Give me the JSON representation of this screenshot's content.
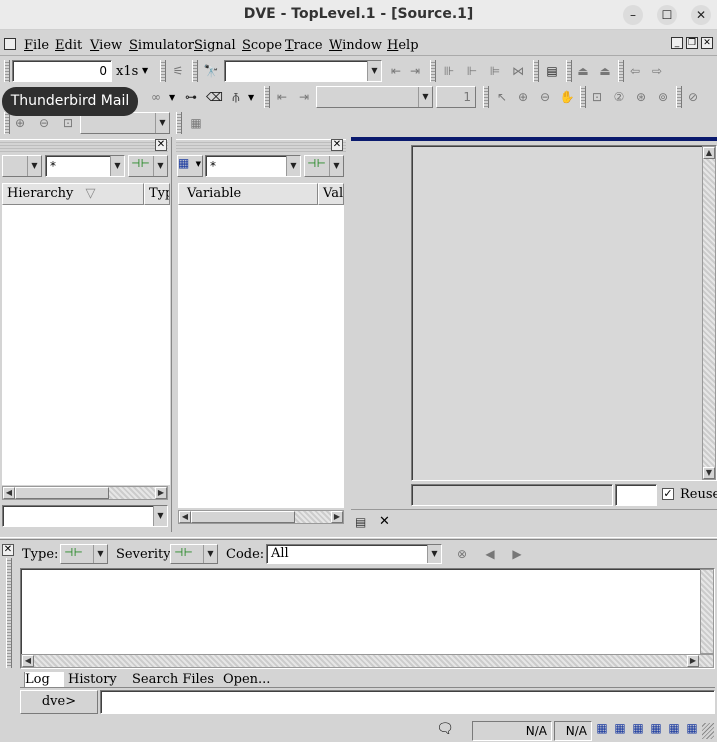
{
  "window": {
    "title": "DVE - TopLevel.1 - [Source.1]",
    "controls": {
      "minimize": "–",
      "maximize": "☐",
      "close": "✕"
    }
  },
  "menubar": {
    "items": [
      "File",
      "Edit",
      "View",
      "Simulator",
      "Signal",
      "Scope",
      "Trace",
      "Window",
      "Help"
    ]
  },
  "toolbar": {
    "time_value": "0",
    "time_unit": "x1s",
    "search_value": "",
    "step_value": "1"
  },
  "tooltip": {
    "text": "Thunderbird Mail"
  },
  "hierarchy_pane": {
    "filter_value": "*",
    "columns": [
      "Hierarchy",
      "Typ"
    ]
  },
  "variable_pane": {
    "filter_value": "*",
    "columns": [
      "Variable",
      "Val"
    ]
  },
  "source_pane": {
    "reuse_label": "Reuse",
    "reuse_checked": true
  },
  "console": {
    "type_label": "Type:",
    "severity_label": "Severity:",
    "code_label": "Code:",
    "code_value": "All",
    "tabs": [
      "Log",
      "History",
      "Search Files",
      "Open..."
    ],
    "prompt": "dve>",
    "command_value": ""
  },
  "statusbar": {
    "cell1": "N/A",
    "cell2": "N/A"
  }
}
